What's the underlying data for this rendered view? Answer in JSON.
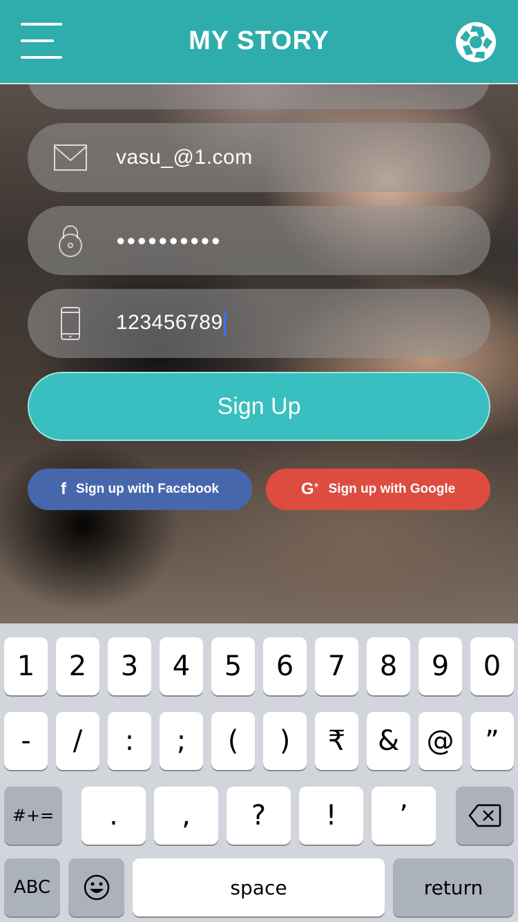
{
  "header": {
    "title": "MY STORY",
    "accent_color": "#2fadac",
    "menu_icon": "hamburger-menu-icon",
    "logo_icon": "aperture-logo-icon"
  },
  "form": {
    "email": {
      "icon": "envelope-icon",
      "value": "vasu_@1.com"
    },
    "password": {
      "icon": "lock-icon",
      "value": "●●●●●●●●●●"
    },
    "phone": {
      "icon": "mobile-phone-icon",
      "value": "123456789"
    }
  },
  "actions": {
    "signup_label": "Sign Up",
    "facebook_label": "Sign up with Facebook",
    "google_label": "Sign up with Google",
    "facebook_color": "#4767ad",
    "google_color": "#de4c40",
    "signup_color": "#39bfbf"
  },
  "keyboard": {
    "row1": [
      "1",
      "2",
      "3",
      "4",
      "5",
      "6",
      "7",
      "8",
      "9",
      "0"
    ],
    "row2": [
      "-",
      "/",
      ":",
      ";",
      "(",
      ")",
      "₹",
      "&",
      "@",
      "”"
    ],
    "row3": [
      ".",
      ",",
      "?",
      "!",
      "’"
    ],
    "shift_label": "#+=",
    "abc_label": "ABC",
    "space_label": "space",
    "return_label": "return",
    "delete_icon": "backspace-icon",
    "emoji_icon": "emoji-icon"
  }
}
